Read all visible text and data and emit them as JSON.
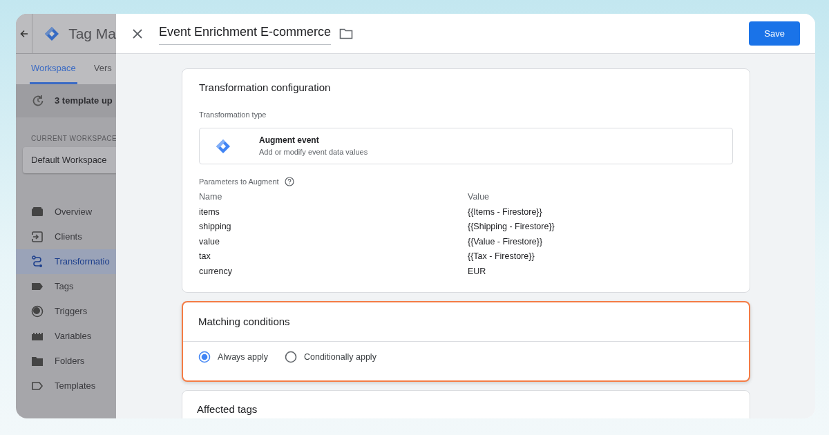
{
  "sidebar": {
    "app_name": "Tag Ma",
    "tabs": [
      {
        "label": "Workspace",
        "selected": true
      },
      {
        "label": "Vers",
        "selected": false
      }
    ],
    "notice": "3 template up",
    "workspace_label": "CURRENT WORKSPACE",
    "workspace": "Default Workspace",
    "nav": [
      {
        "label": "Overview",
        "kind": "overview",
        "selected": false
      },
      {
        "label": "Clients",
        "kind": "clients",
        "selected": false
      },
      {
        "label": "Transformatio",
        "kind": "transformations",
        "selected": true
      },
      {
        "label": "Tags",
        "kind": "tags",
        "selected": false
      },
      {
        "label": "Triggers",
        "kind": "triggers",
        "selected": false
      },
      {
        "label": "Variables",
        "kind": "variables",
        "selected": false
      },
      {
        "label": "Folders",
        "kind": "folders",
        "selected": false
      },
      {
        "label": "Templates",
        "kind": "templates",
        "selected": false
      }
    ]
  },
  "panel": {
    "title": "Event Enrichment E-commerce",
    "save_button": "Save",
    "configuration": {
      "title": "Transformation configuration",
      "type_label": "Transformation type",
      "type": {
        "name": "Augment event",
        "description": "Add or modify event data values"
      },
      "parameters_label": "Parameters to Augment",
      "columns": [
        "Name",
        "Value"
      ],
      "rows": [
        {
          "name": "items",
          "value": "{{Items - Firestore}}"
        },
        {
          "name": "shipping",
          "value": "{{Shipping - Firestore}}"
        },
        {
          "name": "value",
          "value": "{{Value - Firestore}}"
        },
        {
          "name": "tax",
          "value": "{{Tax - Firestore}}"
        },
        {
          "name": "currency",
          "value": "EUR"
        }
      ]
    },
    "matching": {
      "title": "Matching conditions",
      "highlighted": true,
      "options": [
        {
          "label": "Always apply",
          "selected": true
        },
        {
          "label": "Conditionally apply",
          "selected": false
        }
      ]
    },
    "affected": {
      "title": "Affected tags"
    }
  }
}
